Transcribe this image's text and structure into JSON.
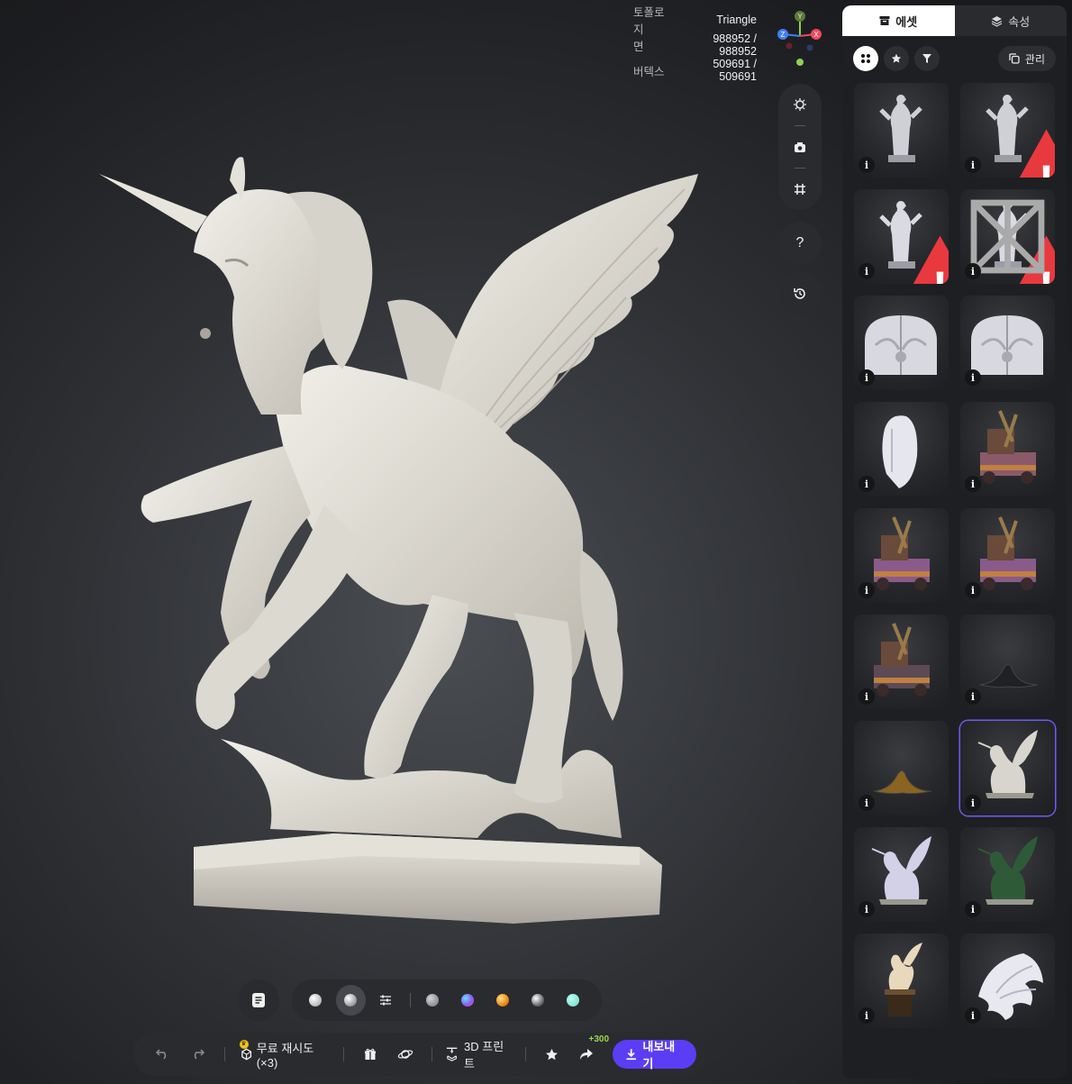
{
  "stats": {
    "topology_label": "토폴로지",
    "topology_value": "Triangle",
    "faces_label": "면",
    "faces_value": "988952 / 988952",
    "vertices_label": "버텍스",
    "vertices_value": "509691 / 509691"
  },
  "gizmo": {
    "y": "Y",
    "z": "Z",
    "x": "X"
  },
  "side_tools": {
    "help_label": "?"
  },
  "materials": [
    {
      "name": "matte-white",
      "color": "#d9d9d9"
    },
    {
      "name": "clay",
      "color": "#bfbfbf"
    },
    {
      "name": "gray",
      "color": "#9a9ea3"
    },
    {
      "name": "iridescent",
      "color": "#8a5cf0"
    },
    {
      "name": "gold",
      "color": "#e98a1c"
    },
    {
      "name": "chrome",
      "color": "#8d8f93"
    },
    {
      "name": "teal",
      "color": "#6fd7c6"
    }
  ],
  "toolbar": {
    "regenerate_label": "무료 재시도 (×3)",
    "print_label": "3D 프린트",
    "points_badge": "+300",
    "export_label": "내보내기"
  },
  "panel": {
    "tab_assets": "에셋",
    "tab_properties": "속성",
    "manage_label": "관리",
    "info_glyph": "i",
    "warning_glyph": "!"
  },
  "assets": [
    {
      "kind": "statue",
      "tint": "#cfd0d6",
      "warn": false
    },
    {
      "kind": "statue",
      "tint": "#cfd0d6",
      "warn": true
    },
    {
      "kind": "statue",
      "tint": "#d9dae2",
      "warn": true
    },
    {
      "kind": "statue",
      "tint": "#d9dae2",
      "warn": true,
      "wire": true
    },
    {
      "kind": "panel",
      "tint": "#d8d9e0",
      "warn": false
    },
    {
      "kind": "panel",
      "tint": "#d8d9e0",
      "warn": false
    },
    {
      "kind": "slab",
      "tint": "#e6e7ee",
      "warn": false
    },
    {
      "kind": "truck",
      "tint": "#8a5a6b",
      "warn": false
    },
    {
      "kind": "truck",
      "tint": "#8a5a8b",
      "warn": false
    },
    {
      "kind": "truck",
      "tint": "#8a5a8b",
      "warn": false
    },
    {
      "kind": "truck",
      "tint": "#5c4a55",
      "warn": false
    },
    {
      "kind": "ornament",
      "tint": "#202124",
      "warn": false
    },
    {
      "kind": "ornament",
      "tint": "#8a6420",
      "warn": false
    },
    {
      "kind": "pegasus",
      "tint": "#d8d6cc",
      "warn": false,
      "selected": true
    },
    {
      "kind": "pegasus",
      "tint": "#d2d1e8",
      "warn": false
    },
    {
      "kind": "pegasus",
      "tint": "#2f5a38",
      "warn": false
    },
    {
      "kind": "pegasus-plinth",
      "tint": "#e8d8bc",
      "warn": false
    },
    {
      "kind": "shell",
      "tint": "#e8e8f0",
      "warn": false
    }
  ]
}
